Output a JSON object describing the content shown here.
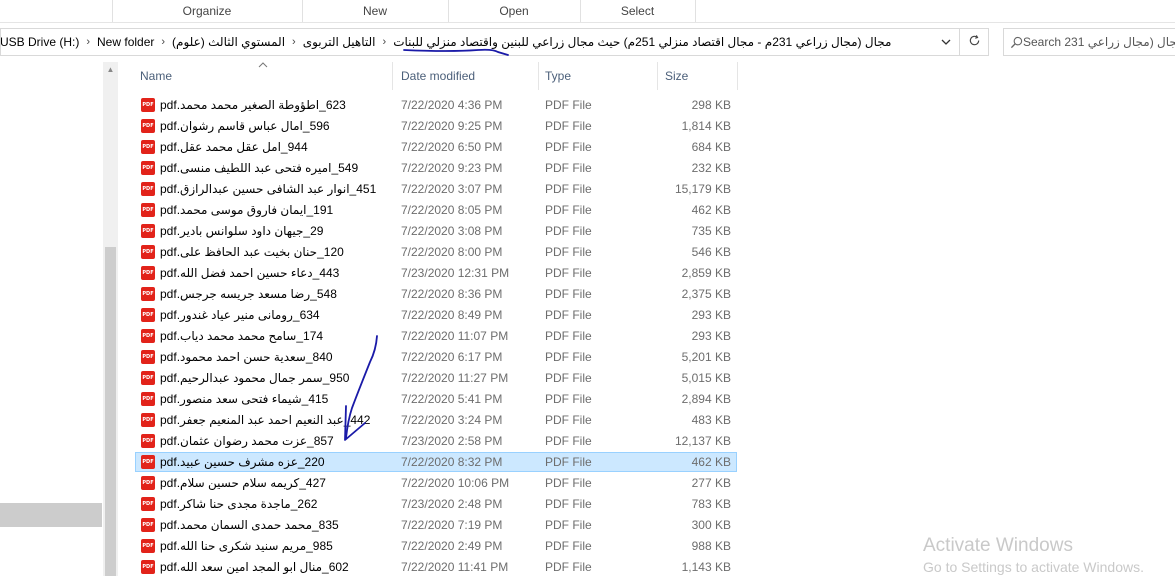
{
  "ribbon": {
    "groups": [
      "Organize",
      "New",
      "Open",
      "Select"
    ]
  },
  "address": {
    "crumbs": [
      "USB Drive (H:)",
      "New folder",
      "المستوي الثالث (علوم)",
      "التاهيل التربوى",
      "مجال (مجال زراعي 231م - مجال اقتصاد منزلي 251م) حيث مجال زراعي للبنين واقتصاد منزلي للبنات"
    ],
    "dropdown_icon": "chevron-down-icon",
    "refresh_icon": "refresh-icon"
  },
  "search": {
    "placeholder": "Search 231 مجال (مجال زراعي",
    "icon": "search-icon"
  },
  "columns": {
    "name": "Name",
    "date": "Date modified",
    "type": "Type",
    "size": "Size"
  },
  "files": [
    {
      "name": "623_اطؤوطة الصغير محمد محمد.pdf",
      "date": "7/22/2020 4:36 PM",
      "type": "PDF File",
      "size": "298 KB"
    },
    {
      "name": "596_امال عباس قاسم  رشوان.pdf",
      "date": "7/22/2020 9:25 PM",
      "type": "PDF File",
      "size": "1,814 KB"
    },
    {
      "name": "944_امل عقل محمد عقل.pdf",
      "date": "7/22/2020 6:50 PM",
      "type": "PDF File",
      "size": "684 KB"
    },
    {
      "name": "549_اميره فتحى عبد اللطيف منسى.pdf",
      "date": "7/22/2020 9:23 PM",
      "type": "PDF File",
      "size": "232 KB"
    },
    {
      "name": "451_انوار عبد الشافى حسين عبدالرازق.pdf",
      "date": "7/22/2020 3:07 PM",
      "type": "PDF File",
      "size": "15,179 KB"
    },
    {
      "name": "191_ايمان فاروق موسى محمد.pdf",
      "date": "7/22/2020 8:05 PM",
      "type": "PDF File",
      "size": "462 KB"
    },
    {
      "name": "29_جيهان داود سلوانس  بادير.pdf",
      "date": "7/22/2020 3:08 PM",
      "type": "PDF File",
      "size": "735 KB"
    },
    {
      "name": "120_حنان بخيت عبد الحافظ على.pdf",
      "date": "7/22/2020 8:00 PM",
      "type": "PDF File",
      "size": "546 KB"
    },
    {
      "name": "443_دعاء حسين احمد فضل الله.pdf",
      "date": "7/23/2020 12:31 PM",
      "type": "PDF File",
      "size": "2,859 KB"
    },
    {
      "name": "548_رضا مسعد جريسه جرجس.pdf",
      "date": "7/22/2020 8:36 PM",
      "type": "PDF File",
      "size": "2,375 KB"
    },
    {
      "name": "634_رومانى منير عياد غندور.pdf",
      "date": "7/22/2020 8:49 PM",
      "type": "PDF File",
      "size": "293 KB"
    },
    {
      "name": "174_سامح محمد محمد دياب.pdf",
      "date": "7/22/2020 11:07 PM",
      "type": "PDF File",
      "size": "293 KB"
    },
    {
      "name": "840_سعدية حسن احمد محمود.pdf",
      "date": "7/22/2020 6:17 PM",
      "type": "PDF File",
      "size": "5,201 KB"
    },
    {
      "name": "950_سمر جمال محمود عبدالرحيم.pdf",
      "date": "7/22/2020 11:27 PM",
      "type": "PDF File",
      "size": "5,015 KB"
    },
    {
      "name": "415_شيماء فتحى سعد منصور.pdf",
      "date": "7/22/2020 5:41 PM",
      "type": "PDF File",
      "size": "2,894 KB"
    },
    {
      "name": "442_عبد النعيم احمد عبد المنعيم  جعفر.pdf",
      "date": "7/22/2020 3:24 PM",
      "type": "PDF File",
      "size": "483 KB"
    },
    {
      "name": "857_عزت محمد رضوان عثمان.pdf",
      "date": "7/23/2020 2:58 PM",
      "type": "PDF File",
      "size": "12,137 KB"
    },
    {
      "name": "220_عزه مشرف حسين عبيد.pdf",
      "date": "7/22/2020 8:32 PM",
      "type": "PDF File",
      "size": "462 KB",
      "selected": true
    },
    {
      "name": "427_كريمه سلام حسين سلام.pdf",
      "date": "7/22/2020 10:06 PM",
      "type": "PDF File",
      "size": "277 KB"
    },
    {
      "name": "262_ماجدة مجدى حنا شاكر.pdf",
      "date": "7/23/2020 2:48 PM",
      "type": "PDF File",
      "size": "783 KB"
    },
    {
      "name": "835_محمد حمدى السمان محمد.pdf",
      "date": "7/22/2020 7:19 PM",
      "type": "PDF File",
      "size": "300 KB"
    },
    {
      "name": "985_مريم سنيد شكرى حنا الله.pdf",
      "date": "7/22/2020 2:49 PM",
      "type": "PDF File",
      "size": "988 KB"
    },
    {
      "name": "602_منال ابو المجد امين سعد الله.pdf",
      "date": "7/22/2020 11:41 PM",
      "type": "PDF File",
      "size": "1,143 KB"
    }
  ],
  "watermark": {
    "title": "Activate Windows",
    "subtitle": "Go to Settings to activate Windows."
  },
  "annotation_color": "#1a1aa8"
}
